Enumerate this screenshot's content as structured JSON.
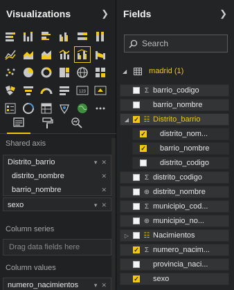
{
  "visualizations": {
    "title": "Visualizations",
    "tabs": [
      {
        "icon": "fields-icon",
        "active": true
      },
      {
        "icon": "format-paint-roller-icon",
        "active": false
      },
      {
        "icon": "analytics-magnifier-icon",
        "active": false
      }
    ],
    "wells": {
      "shared_axis": {
        "label": "Shared axis",
        "hierarchy": "Distrito_barrio",
        "levels": [
          "distrito_nombre",
          "barrio_nombre"
        ],
        "extra": "sexo"
      },
      "column_series": {
        "label": "Column series",
        "placeholder": "Drag data fields here"
      },
      "column_values": {
        "label": "Column values",
        "field": "numero_nacimientos"
      }
    }
  },
  "fields": {
    "title": "Fields",
    "search": {
      "placeholder": "Search"
    },
    "table": {
      "name": "madrid (1)"
    },
    "items": [
      {
        "name": "barrio_codigo",
        "type": "sigma",
        "checked": false
      },
      {
        "name": "barrio_nombre",
        "type": "",
        "checked": false
      },
      {
        "name": "Distrito_barrio",
        "type": "hierarchy",
        "checked": true,
        "expanded": true
      },
      {
        "name": "distrito_nom...",
        "type": "",
        "checked": true,
        "child": true
      },
      {
        "name": "barrio_nombre",
        "type": "",
        "checked": true,
        "child": true
      },
      {
        "name": "distrito_codigo",
        "type": "",
        "checked": false,
        "child": true
      },
      {
        "name": "distrito_codigo",
        "type": "sigma",
        "checked": false
      },
      {
        "name": "distrito_nombre",
        "type": "globe",
        "checked": false
      },
      {
        "name": "municipio_cod...",
        "type": "sigma",
        "checked": false
      },
      {
        "name": "municipio_no...",
        "type": "globe",
        "checked": false
      },
      {
        "name": "Nacimientos",
        "type": "hierarchy",
        "checked": false,
        "expanded": false
      },
      {
        "name": "numero_nacim...",
        "type": "sigma",
        "checked": true
      },
      {
        "name": "provincia_naci...",
        "type": "",
        "checked": false
      },
      {
        "name": "sexo",
        "type": "",
        "checked": true
      }
    ]
  },
  "colors": {
    "accent": "#f2c811",
    "panel": "#202122"
  }
}
